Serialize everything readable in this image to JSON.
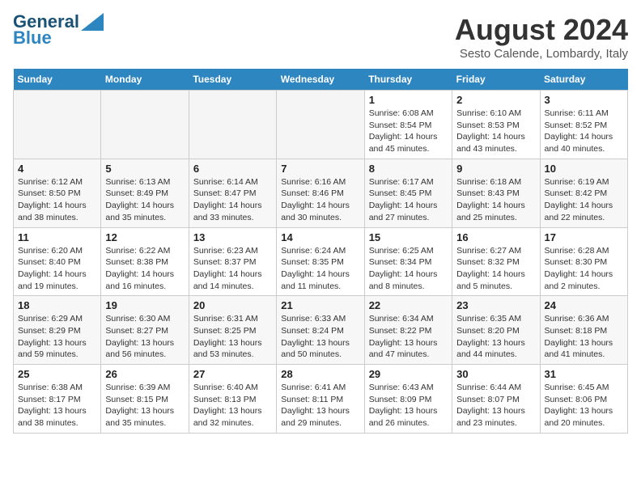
{
  "header": {
    "logo_line1": "General",
    "logo_line2": "Blue",
    "month_title": "August 2024",
    "subtitle": "Sesto Calende, Lombardy, Italy"
  },
  "weekdays": [
    "Sunday",
    "Monday",
    "Tuesday",
    "Wednesday",
    "Thursday",
    "Friday",
    "Saturday"
  ],
  "weeks": [
    [
      {
        "day": "",
        "info": "",
        "empty": true
      },
      {
        "day": "",
        "info": "",
        "empty": true
      },
      {
        "day": "",
        "info": "",
        "empty": true
      },
      {
        "day": "",
        "info": "",
        "empty": true
      },
      {
        "day": "1",
        "info": "Sunrise: 6:08 AM\nSunset: 8:54 PM\nDaylight: 14 hours and 45 minutes."
      },
      {
        "day": "2",
        "info": "Sunrise: 6:10 AM\nSunset: 8:53 PM\nDaylight: 14 hours and 43 minutes."
      },
      {
        "day": "3",
        "info": "Sunrise: 6:11 AM\nSunset: 8:52 PM\nDaylight: 14 hours and 40 minutes."
      }
    ],
    [
      {
        "day": "4",
        "info": "Sunrise: 6:12 AM\nSunset: 8:50 PM\nDaylight: 14 hours and 38 minutes."
      },
      {
        "day": "5",
        "info": "Sunrise: 6:13 AM\nSunset: 8:49 PM\nDaylight: 14 hours and 35 minutes."
      },
      {
        "day": "6",
        "info": "Sunrise: 6:14 AM\nSunset: 8:47 PM\nDaylight: 14 hours and 33 minutes."
      },
      {
        "day": "7",
        "info": "Sunrise: 6:16 AM\nSunset: 8:46 PM\nDaylight: 14 hours and 30 minutes."
      },
      {
        "day": "8",
        "info": "Sunrise: 6:17 AM\nSunset: 8:45 PM\nDaylight: 14 hours and 27 minutes."
      },
      {
        "day": "9",
        "info": "Sunrise: 6:18 AM\nSunset: 8:43 PM\nDaylight: 14 hours and 25 minutes."
      },
      {
        "day": "10",
        "info": "Sunrise: 6:19 AM\nSunset: 8:42 PM\nDaylight: 14 hours and 22 minutes."
      }
    ],
    [
      {
        "day": "11",
        "info": "Sunrise: 6:20 AM\nSunset: 8:40 PM\nDaylight: 14 hours and 19 minutes."
      },
      {
        "day": "12",
        "info": "Sunrise: 6:22 AM\nSunset: 8:38 PM\nDaylight: 14 hours and 16 minutes."
      },
      {
        "day": "13",
        "info": "Sunrise: 6:23 AM\nSunset: 8:37 PM\nDaylight: 14 hours and 14 minutes."
      },
      {
        "day": "14",
        "info": "Sunrise: 6:24 AM\nSunset: 8:35 PM\nDaylight: 14 hours and 11 minutes."
      },
      {
        "day": "15",
        "info": "Sunrise: 6:25 AM\nSunset: 8:34 PM\nDaylight: 14 hours and 8 minutes."
      },
      {
        "day": "16",
        "info": "Sunrise: 6:27 AM\nSunset: 8:32 PM\nDaylight: 14 hours and 5 minutes."
      },
      {
        "day": "17",
        "info": "Sunrise: 6:28 AM\nSunset: 8:30 PM\nDaylight: 14 hours and 2 minutes."
      }
    ],
    [
      {
        "day": "18",
        "info": "Sunrise: 6:29 AM\nSunset: 8:29 PM\nDaylight: 13 hours and 59 minutes."
      },
      {
        "day": "19",
        "info": "Sunrise: 6:30 AM\nSunset: 8:27 PM\nDaylight: 13 hours and 56 minutes."
      },
      {
        "day": "20",
        "info": "Sunrise: 6:31 AM\nSunset: 8:25 PM\nDaylight: 13 hours and 53 minutes."
      },
      {
        "day": "21",
        "info": "Sunrise: 6:33 AM\nSunset: 8:24 PM\nDaylight: 13 hours and 50 minutes."
      },
      {
        "day": "22",
        "info": "Sunrise: 6:34 AM\nSunset: 8:22 PM\nDaylight: 13 hours and 47 minutes."
      },
      {
        "day": "23",
        "info": "Sunrise: 6:35 AM\nSunset: 8:20 PM\nDaylight: 13 hours and 44 minutes."
      },
      {
        "day": "24",
        "info": "Sunrise: 6:36 AM\nSunset: 8:18 PM\nDaylight: 13 hours and 41 minutes."
      }
    ],
    [
      {
        "day": "25",
        "info": "Sunrise: 6:38 AM\nSunset: 8:17 PM\nDaylight: 13 hours and 38 minutes."
      },
      {
        "day": "26",
        "info": "Sunrise: 6:39 AM\nSunset: 8:15 PM\nDaylight: 13 hours and 35 minutes."
      },
      {
        "day": "27",
        "info": "Sunrise: 6:40 AM\nSunset: 8:13 PM\nDaylight: 13 hours and 32 minutes."
      },
      {
        "day": "28",
        "info": "Sunrise: 6:41 AM\nSunset: 8:11 PM\nDaylight: 13 hours and 29 minutes."
      },
      {
        "day": "29",
        "info": "Sunrise: 6:43 AM\nSunset: 8:09 PM\nDaylight: 13 hours and 26 minutes."
      },
      {
        "day": "30",
        "info": "Sunrise: 6:44 AM\nSunset: 8:07 PM\nDaylight: 13 hours and 23 minutes."
      },
      {
        "day": "31",
        "info": "Sunrise: 6:45 AM\nSunset: 8:06 PM\nDaylight: 13 hours and 20 minutes."
      }
    ]
  ]
}
